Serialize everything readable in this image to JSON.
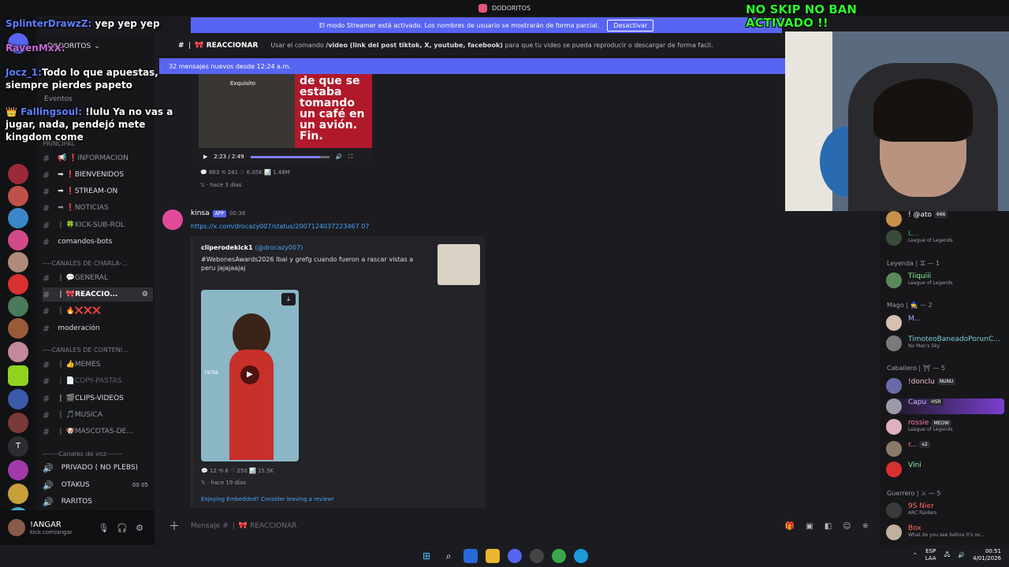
{
  "window": {
    "title": "DODORITOS"
  },
  "streamer_bar": {
    "text": "El modo Streamer está activado. Los nombres de usuario se mostrarán de forma parcial.",
    "button": "Desactivar"
  },
  "server": {
    "name": "DODORITOS",
    "events": "Eventos"
  },
  "channel_header": {
    "name": "REACCIONAR",
    "topic_pre": "Usar el comando ",
    "topic_cmd": "/video (link del post tiktok, X, youtube, facebook)",
    "topic_post": " para que tu video se pueda reproducir o descargar de forma facil."
  },
  "new_messages": "32 mensajes nuevos desde 12:24 a.m.",
  "categories": {
    "principal": "PRINCIPAL",
    "charla": "----CANALES DE CHARLA-...",
    "contenido": "----CANALES DE CONTENI...",
    "voz": "-------Canales de voz-------"
  },
  "channels": [
    "INFORMACION",
    "BIENVENIDOS",
    "STREAM-ON",
    "NOTICIAS",
    "KICK-SUB-ROL",
    "comandos-bots",
    "GENERAL",
    "REACCIO...",
    "❌❌❌",
    "moderación",
    "MEMES",
    "COPY-PASTAS",
    "CLIPS-VIDEOS",
    "MUSICA",
    "MASCOTAS-DE..."
  ],
  "voice": {
    "privado": "PRIVADO ( NO PLEBS)",
    "otakus": "OTAKUS",
    "otakus_count": "00",
    "otakus_max": "05",
    "raritos": "RARITOS"
  },
  "user": {
    "name": "!ANGAR",
    "status": "kick.com/angar"
  },
  "prev_embed": {
    "label": "Exquisito",
    "text": "de que se estaba tomando un café en un avión. Fin.",
    "time": "2:23 / 2:49",
    "replies": "863",
    "reposts": "281",
    "likes": "6.05K",
    "views": "1.48M",
    "ago": "hace 3 días",
    "progress": 0.88
  },
  "message": {
    "author": "kinsa",
    "badge": "APP",
    "time": "00:38",
    "link": "https://x.com/drocazy007/status/2007124037223467 07"
  },
  "embed": {
    "author": "cliperodekick1",
    "handle": "(@drocazy007)",
    "text": "#WebonesAwards2026 Ibai y grefg cuando fueron a rascar vistas a peru jajajaajaj",
    "replies": "12",
    "reposts": "8",
    "likes": "250",
    "views": "15.5K",
    "ago": "hace 19 días",
    "footer": "Enjoying Embedded? Consider leaving a review!",
    "video_label": "TikTok"
  },
  "input": {
    "placeholder": "Mensaje # ",
    "channel": "REACCIONAR"
  },
  "members": {
    "top": [
      {
        "name": "! @ato",
        "tag": "666"
      },
      {
        "name": "L...",
        "status": "League of Legends"
      }
    ],
    "roles": [
      {
        "label": "Leyenda | ♊ — 1",
        "members": [
          {
            "name": "Tiiquiii",
            "status": "League of Legends"
          }
        ]
      },
      {
        "label": "Mago | 🧙 — 2",
        "members": [
          {
            "name": "M..."
          },
          {
            "name": "TimoteoBaneadoPorunC...",
            "status": "No Man's Sky"
          }
        ]
      },
      {
        "label": "Caballero | ⛩ — 5",
        "members": [
          {
            "name": "!donclu",
            "tag": "NUNU"
          },
          {
            "name": "Capu",
            "tag": "HSR"
          },
          {
            "name": "rossie",
            "tag": "MEOW",
            "status": "League of Legends"
          },
          {
            "name": "r...",
            "tag": "x2"
          },
          {
            "name": "Vini"
          }
        ]
      },
      {
        "label": "Guerrero | ⚔ — 5",
        "members": [
          {
            "name": "9S Nier",
            "status": "ARC Raiders"
          },
          {
            "name": "Box",
            "status": "What do you see before it's ov..."
          }
        ]
      }
    ]
  },
  "overlay": {
    "badge_line1": "NO SKIP NO BAN",
    "badge_line2": "ACTIVADO !!"
  },
  "stream_chat": [
    {
      "user": "SplinterDrawzZ:",
      "text": "yep yep yep"
    },
    {
      "user": "RavenMxX:",
      "text": ""
    },
    {
      "user": "Jocz_1:",
      "text": "Todo lo que apuestas, siempre pierdes papeto"
    },
    {
      "user": "Fallingsoul:",
      "text": "!lulu Ya no vas a jugar, nada, pendejó mete kingdom come"
    }
  ],
  "taskbar": {
    "lang1": "ESP",
    "lang2": "LAA",
    "time": "00:51",
    "date": "4/01/2026"
  }
}
